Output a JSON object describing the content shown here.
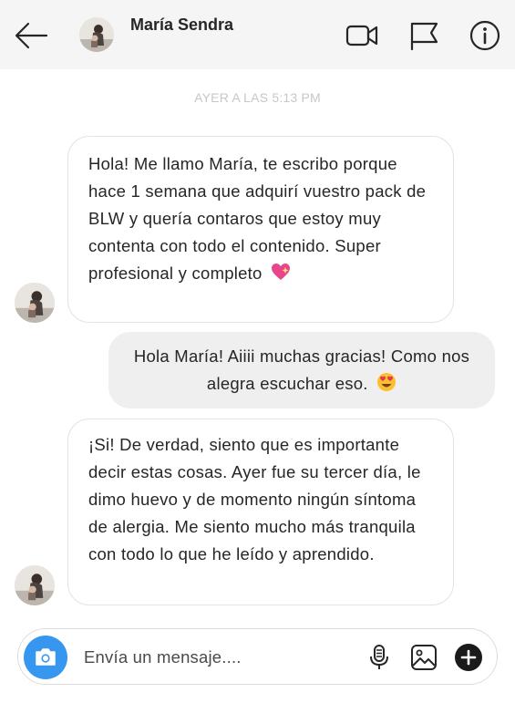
{
  "header": {
    "contact_name": "María Sendra",
    "icons": [
      "back-arrow-icon",
      "video-call-icon",
      "flag-icon",
      "info-icon"
    ]
  },
  "timestamp": "AYER A LAS 5:13 PM",
  "messages": [
    {
      "from": "contact",
      "text": " Hola! Me llamo María, te escribo porque hace 1 semana que adquirí vuestro pack de BLW y quería contaros que estoy muy contenta con todo el contenido. Super profesional y completo",
      "emoji": "sparkling-heart"
    },
    {
      "from": "me",
      "text": "Hola María! Aiiii muchas gracias! Como nos alegra escuchar eso.",
      "emoji": "heart-eyes"
    },
    {
      "from": "contact",
      "text": "¡Si! De verdad, siento que es importante decir estas cosas. Ayer fue su tercer día, le dimo huevo y de momento ningún síntoma de alergia. Me siento mucho más tranquila con todo lo que he leído y aprendido.",
      "emoji": ""
    }
  ],
  "composer": {
    "placeholder": "Envía un mensaje....",
    "icons": [
      "camera-icon",
      "microphone-icon",
      "gallery-icon",
      "plus-icon"
    ]
  },
  "colors": {
    "header_bg": "#f5f5f5",
    "camera_button": "#3797f0",
    "incoming_bubble_border": "#e3e3e3",
    "outgoing_bubble_bg": "#efefef",
    "timestamp_text": "#c7c7c7"
  }
}
